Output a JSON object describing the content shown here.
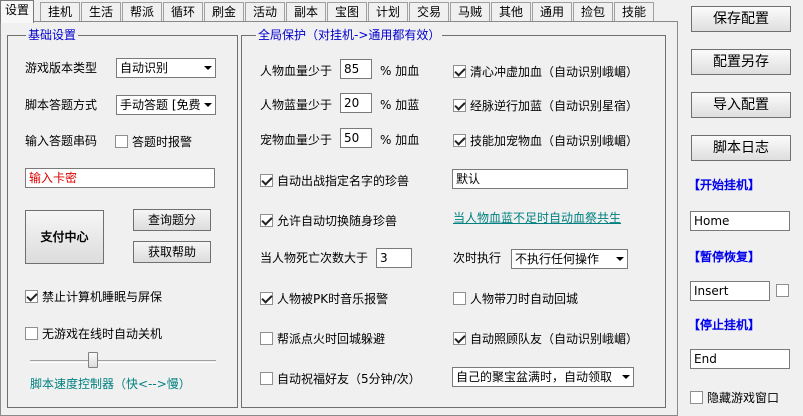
{
  "tabs": [
    "设置",
    "挂机",
    "生活",
    "帮派",
    "循环",
    "刷金",
    "活动",
    "副本",
    "宝图",
    "计划",
    "交易",
    "马贼",
    "其他",
    "通用",
    "捡包",
    "技能"
  ],
  "basic": {
    "legend": "基础设置",
    "version_label": "游戏版本类型",
    "version_value": "自动识别",
    "answer_label": "脚本答题方式",
    "answer_value": "手动答题 [免费]",
    "code_label": "输入答题串码",
    "alarm_label": "答题时报警",
    "alarm_checked": false,
    "card_placeholder": "输入卡密",
    "pay_button": "支付中心",
    "query_button": "查询题分",
    "help_button": "获取帮助",
    "sleep_label": "禁止计算机睡眠与屏保",
    "sleep_checked": true,
    "shutdown_label": "无游戏在线时自动关机",
    "shutdown_checked": false,
    "speed_label": "脚本速度控制器（快<-->慢）",
    "speed_level": 0.35
  },
  "global": {
    "legend": "全局保护（对挂机->通用都有效）",
    "hp_label": "人物血量少于",
    "hp_value": "85",
    "hp_suffix": "% 加血",
    "mp_label": "人物蓝量少于",
    "mp_value": "20",
    "mp_suffix": "% 加蓝",
    "pet_label": "宠物血量少于",
    "pet_value": "50",
    "pet_suffix": "% 加血",
    "qingxin_label": "清心冲虚加血（自动识别峨嵋）",
    "qingxin_checked": true,
    "jingmai_label": "经脉逆行加蓝（自动识别星宿）",
    "jingmai_checked": true,
    "skillpet_label": "技能加宠物血（自动识别峨嵋）",
    "skillpet_checked": true,
    "summon_label": "自动出战指定名字的珍兽",
    "summon_checked": true,
    "summon_value": "默认",
    "switch_label": "允许自动切换随身珍兽",
    "switch_checked": true,
    "link_text": "当人物血蓝不足时自动血祭共生",
    "death_label": "当人物死亡次数大于",
    "death_value": "3",
    "exec_label": "次时执行",
    "exec_value": "不执行任何操作",
    "pk_label": "人物被PK时音乐报警",
    "pk_checked": true,
    "knife_label": "人物带刀时自动回城",
    "knife_checked": false,
    "fire_label": "帮派点火时回城躲避",
    "fire_checked": false,
    "team_label": "自动照顾队友（自动识别峨嵋）",
    "team_checked": true,
    "bless_label": "自动祝福好友（5分钟/次）",
    "bless_checked": false,
    "treasure_value": "自己的聚宝盆满时，自动领取"
  },
  "side": {
    "save_button": "保存配置",
    "saveas_button": "配置另存",
    "import_button": "导入配置",
    "log_button": "脚本日志",
    "start_label": "【开始挂机】",
    "start_key": "Home",
    "pause_label": "【暂停恢复】",
    "pause_key": "Insert",
    "pause_checked": false,
    "stop_label": "【停止挂机】",
    "stop_key": "End",
    "hide_label": "隐藏游戏窗口",
    "hide_checked": false
  }
}
